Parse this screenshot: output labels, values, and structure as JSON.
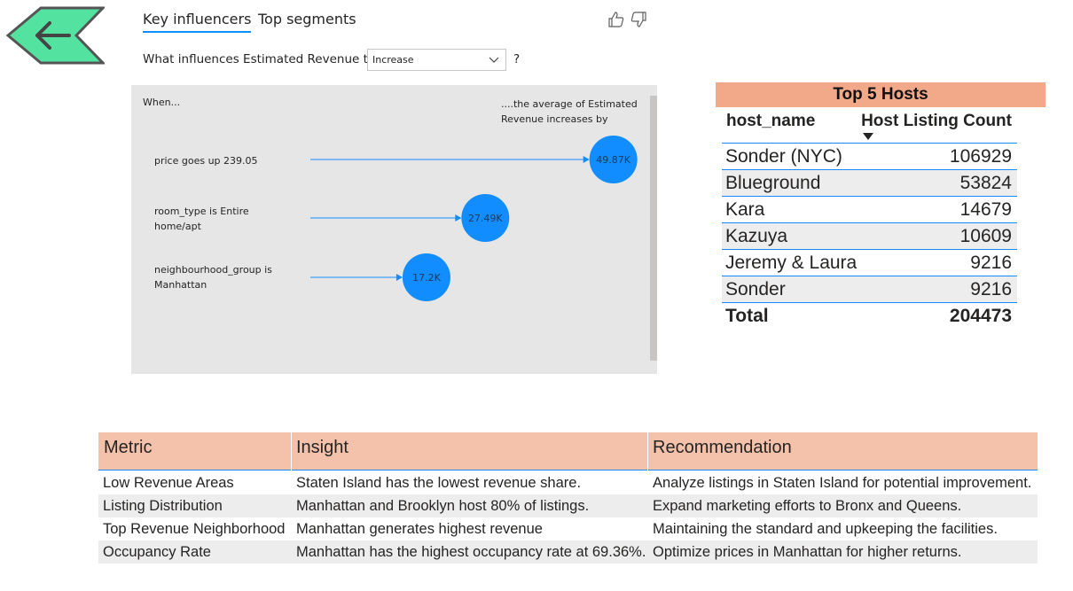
{
  "colors": {
    "back_arrow_fill": "#54e2a0",
    "accent": "#118dff",
    "bubble": "#118dff",
    "hosts_title_bg": "#f2a98a",
    "insights_header_bg": "#f4c2ab"
  },
  "back_button": {
    "icon": "back-arrow-icon"
  },
  "key_influencers": {
    "tabs": [
      "Key influencers",
      "Top segments"
    ],
    "active_tab": "Key influencers",
    "question_prefix": "What influences Estimated Revenue to",
    "select_value": "Increase",
    "question_suffix": "?",
    "when_label": "When...",
    "avg_label": "....the average of Estimated Revenue increases by",
    "factors": [
      {
        "label": "price goes up 239.05",
        "value_label": "49.87K",
        "value": 49.87
      },
      {
        "label": "room_type is Entire home/apt",
        "value_label": "27.49K",
        "value": 27.49
      },
      {
        "label": "neighbourhood_group is Manhattan",
        "value_label": "17.2K",
        "value": 17.2
      }
    ]
  },
  "top_hosts": {
    "title": "Top 5 Hosts",
    "columns": [
      "host_name",
      "Host Listing Count"
    ],
    "rows": [
      {
        "name": "Sonder (NYC)",
        "count": "106929"
      },
      {
        "name": "Blueground",
        "count": "53824"
      },
      {
        "name": "Kara",
        "count": "14679"
      },
      {
        "name": "Kazuya",
        "count": "10609"
      },
      {
        "name": "Jeremy & Laura",
        "count": "9216"
      },
      {
        "name": "Sonder",
        "count": "9216"
      }
    ],
    "total_label": "Total",
    "total_value": "204473"
  },
  "insights": {
    "columns": [
      "Metric",
      "Insight",
      "Recommendation"
    ],
    "rows": [
      [
        "Low Revenue Areas",
        "Staten Island has the lowest revenue share.",
        "Analyze listings in Staten Island for potential improvement."
      ],
      [
        "Listing Distribution",
        "Manhattan and Brooklyn host 80% of listings.",
        "Expand marketing efforts to Bronx and Queens."
      ],
      [
        "Top Revenue Neighborhood",
        "Manhattan generates highest revenue",
        "Maintaining the standard and upkeeping the facilities."
      ],
      [
        "Occupancy Rate",
        "Manhattan has the highest occupancy rate at 69.36%.",
        "Optimize prices in Manhattan for higher returns."
      ]
    ]
  }
}
